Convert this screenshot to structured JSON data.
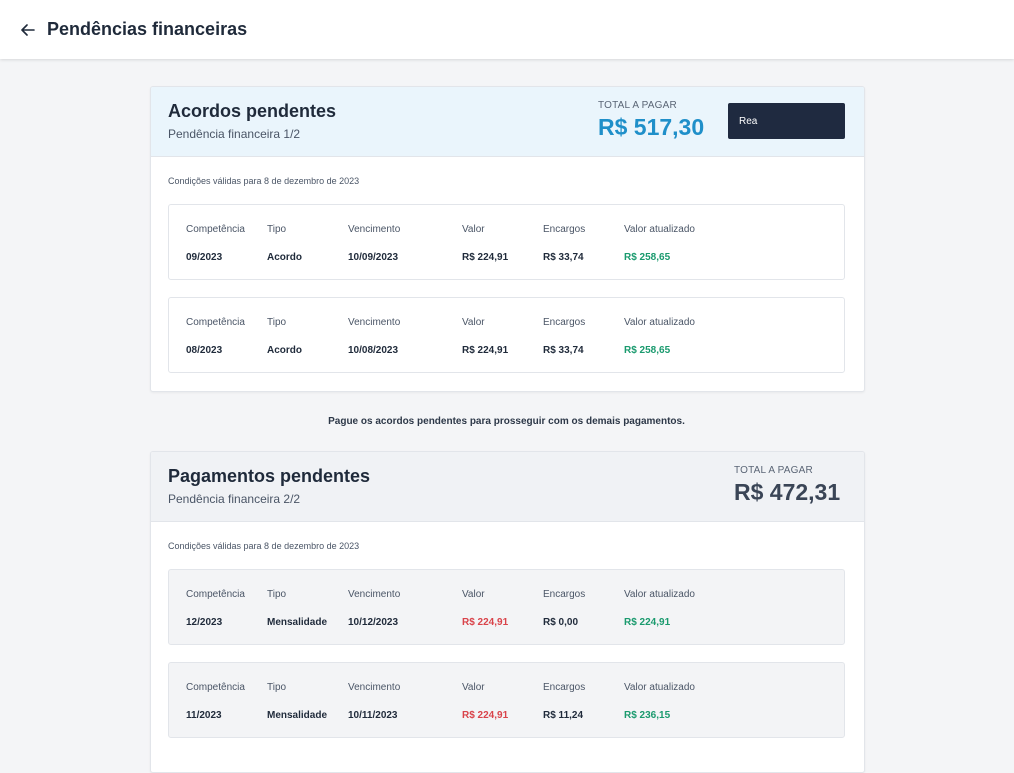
{
  "header": {
    "title": "Pendências financeiras",
    "back_icon": "arrow-left-icon"
  },
  "colors": {
    "accent_blue": "#1f8fc9",
    "green": "#1a9a6e",
    "red": "#d9434a",
    "button": "#1f2a40"
  },
  "column_labels": {
    "competencia": "Competência",
    "tipo": "Tipo",
    "vencimento": "Vencimento",
    "valor": "Valor",
    "encargos": "Encargos",
    "valor_atualizado": "Valor atualizado"
  },
  "agreements": {
    "title": "Acordos pendentes",
    "subtitle": "Pendência financeira 1/2",
    "total_label": "TOTAL A PAGAR",
    "total_value": "R$ 517,30",
    "pay_button": "Rea",
    "conditions": "Condições válidas para 8 de dezembro de 2023",
    "items": [
      {
        "competencia": "09/2023",
        "tipo": "Acordo",
        "vencimento": "10/09/2023",
        "valor": "R$ 224,91",
        "encargos": "R$ 33,74",
        "valor_atualizado": "R$ 258,65"
      },
      {
        "competencia": "08/2023",
        "tipo": "Acordo",
        "vencimento": "10/08/2023",
        "valor": "R$ 224,91",
        "encargos": "R$ 33,74",
        "valor_atualizado": "R$ 258,65"
      }
    ]
  },
  "notice": "Pague os acordos pendentes para prosseguir com os demais pagamentos.",
  "payments": {
    "title": "Pagamentos pendentes",
    "subtitle": "Pendência financeira 2/2",
    "total_label": "TOTAL A PAGAR",
    "total_value": "R$ 472,31",
    "conditions": "Condições válidas para 8 de dezembro de 2023",
    "items": [
      {
        "competencia": "12/2023",
        "tipo": "Mensalidade",
        "vencimento": "10/12/2023",
        "valor": "R$ 224,91",
        "encargos": "R$ 0,00",
        "valor_atualizado": "R$ 224,91"
      },
      {
        "competencia": "11/2023",
        "tipo": "Mensalidade",
        "vencimento": "10/11/2023",
        "valor": "R$ 224,91",
        "encargos": "R$ 11,24",
        "valor_atualizado": "R$ 236,15"
      }
    ]
  }
}
